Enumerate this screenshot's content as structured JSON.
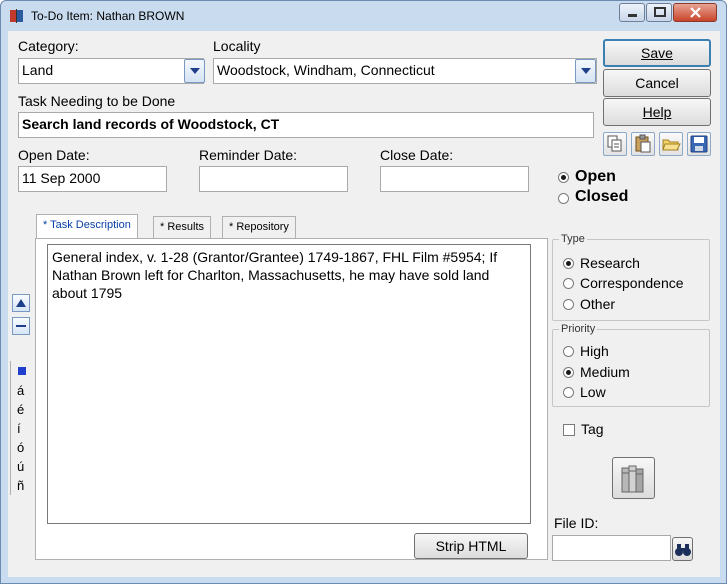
{
  "window": {
    "title": "To-Do Item: Nathan BROWN"
  },
  "category": {
    "label": "Category:",
    "value": "Land"
  },
  "locality": {
    "label": "Locality",
    "value": "Woodstock, Windham, Connecticut"
  },
  "task": {
    "label": "Task Needing to be Done",
    "value": "Search land records of Woodstock, CT"
  },
  "dates": {
    "open_label": "Open Date:",
    "open_value": "11 Sep 2000",
    "reminder_label": "Reminder Date:",
    "reminder_value": "",
    "close_label": "Close Date:",
    "close_value": ""
  },
  "status": {
    "open_label": "Open",
    "closed_label": "Closed",
    "selected": "Open"
  },
  "buttons": {
    "save": "Save",
    "cancel": "Cancel",
    "help": "Help",
    "strip_html": "Strip HTML"
  },
  "tabs": [
    {
      "label": "* Task Description",
      "active": true
    },
    {
      "label": "* Results",
      "active": false
    },
    {
      "label": "* Repository",
      "active": false
    }
  ],
  "description": "General index, v. 1-28 (Grantor/Grantee) 1749-1867, FHL Film #5954; If Nathan Brown left for Charlton, Massachusetts, he may have sold land about 1795",
  "special_chars": [
    "á",
    "é",
    "í",
    "ó",
    "ú",
    "ñ"
  ],
  "type_group": {
    "title": "Type",
    "options": [
      "Research",
      "Correspondence",
      "Other"
    ],
    "selected": "Research"
  },
  "priority_group": {
    "title": "Priority",
    "options": [
      "High",
      "Medium",
      "Low"
    ],
    "selected": "Medium"
  },
  "tag": {
    "label": "Tag",
    "checked": false
  },
  "file_id": {
    "label": "File ID:",
    "value": ""
  },
  "icons": {
    "toolbar": [
      "copy-icon",
      "paste-icon",
      "open-folder-icon",
      "save-disk-icon"
    ],
    "repository": "books-icon",
    "search": "binoculars-icon"
  },
  "colors": {
    "window_frame": "#c9dcef",
    "client_bg": "#f0f0f0",
    "active_tab_text": "#0a3fa8",
    "default_button_border": "#3c7fb1"
  }
}
